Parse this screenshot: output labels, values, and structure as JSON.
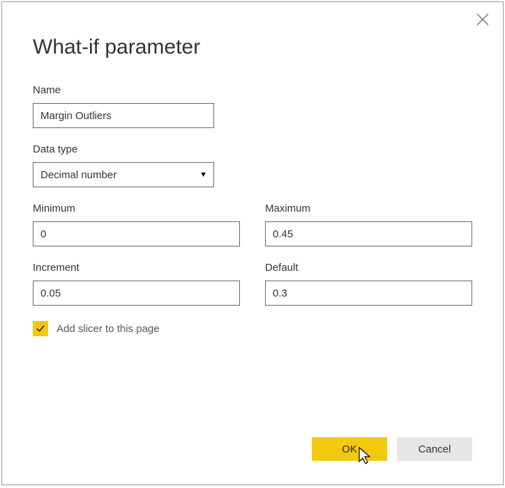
{
  "dialog": {
    "title": "What-if parameter"
  },
  "fields": {
    "name": {
      "label": "Name",
      "value": "Margin Outliers"
    },
    "dataType": {
      "label": "Data type",
      "value": "Decimal number"
    },
    "minimum": {
      "label": "Minimum",
      "value": "0"
    },
    "maximum": {
      "label": "Maximum",
      "value": "0.45"
    },
    "increment": {
      "label": "Increment",
      "value": "0.05"
    },
    "default": {
      "label": "Default",
      "value": "0.3"
    }
  },
  "checkbox": {
    "label": "Add slicer to this page",
    "checked": true
  },
  "buttons": {
    "ok": "OK",
    "cancel": "Cancel"
  }
}
